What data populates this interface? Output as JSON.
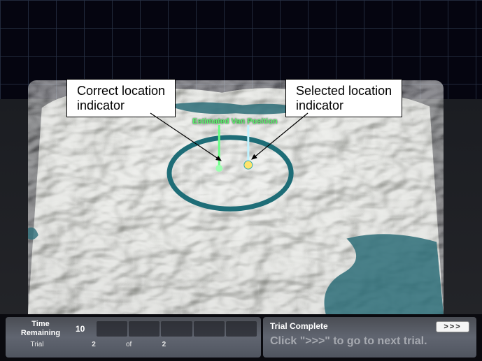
{
  "annotations": {
    "correct": {
      "line1": "Correct location",
      "line2": "indicator"
    },
    "selected": {
      "line1": "Selected location",
      "line2": "indicator"
    }
  },
  "map": {
    "beacon_label": "Estimated Van Position"
  },
  "hud": {
    "time_label_line1": "Time",
    "time_label_line2": "Remaining",
    "time_value": "10",
    "trial_label": "Trial",
    "trial_current": "2",
    "trial_of": "of",
    "trial_total": "2",
    "status": "Trial Complete",
    "instruction": "Click \">>>\" to go to next trial.",
    "next_button": ">>>"
  }
}
